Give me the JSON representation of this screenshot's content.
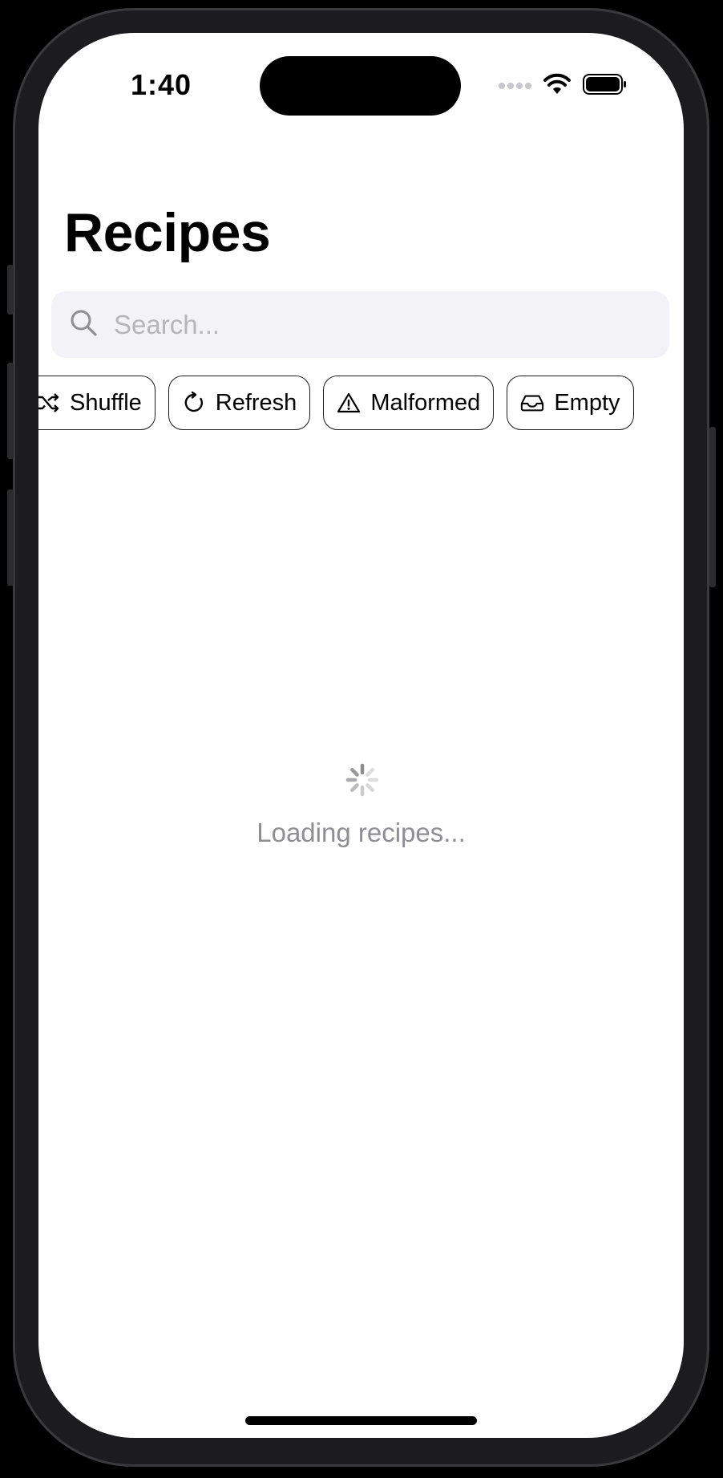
{
  "status_bar": {
    "time": "1:40",
    "icons": [
      "cellular-dots-icon",
      "wifi-icon",
      "battery-icon"
    ]
  },
  "header": {
    "title": "Recipes"
  },
  "search": {
    "placeholder": "Search..."
  },
  "chips": [
    {
      "label": "Shuffle",
      "icon": "shuffle-icon"
    },
    {
      "label": "Refresh",
      "icon": "refresh-icon"
    },
    {
      "label": "Malformed",
      "icon": "warning-icon"
    },
    {
      "label": "Empty",
      "icon": "tray-icon"
    }
  ],
  "loading": {
    "text": "Loading recipes..."
  },
  "colors": {
    "background": "#ffffff",
    "search_fill": "#f2f2f7",
    "secondary_text": "#8e8e93",
    "chip_border": "#1c1c1e"
  }
}
